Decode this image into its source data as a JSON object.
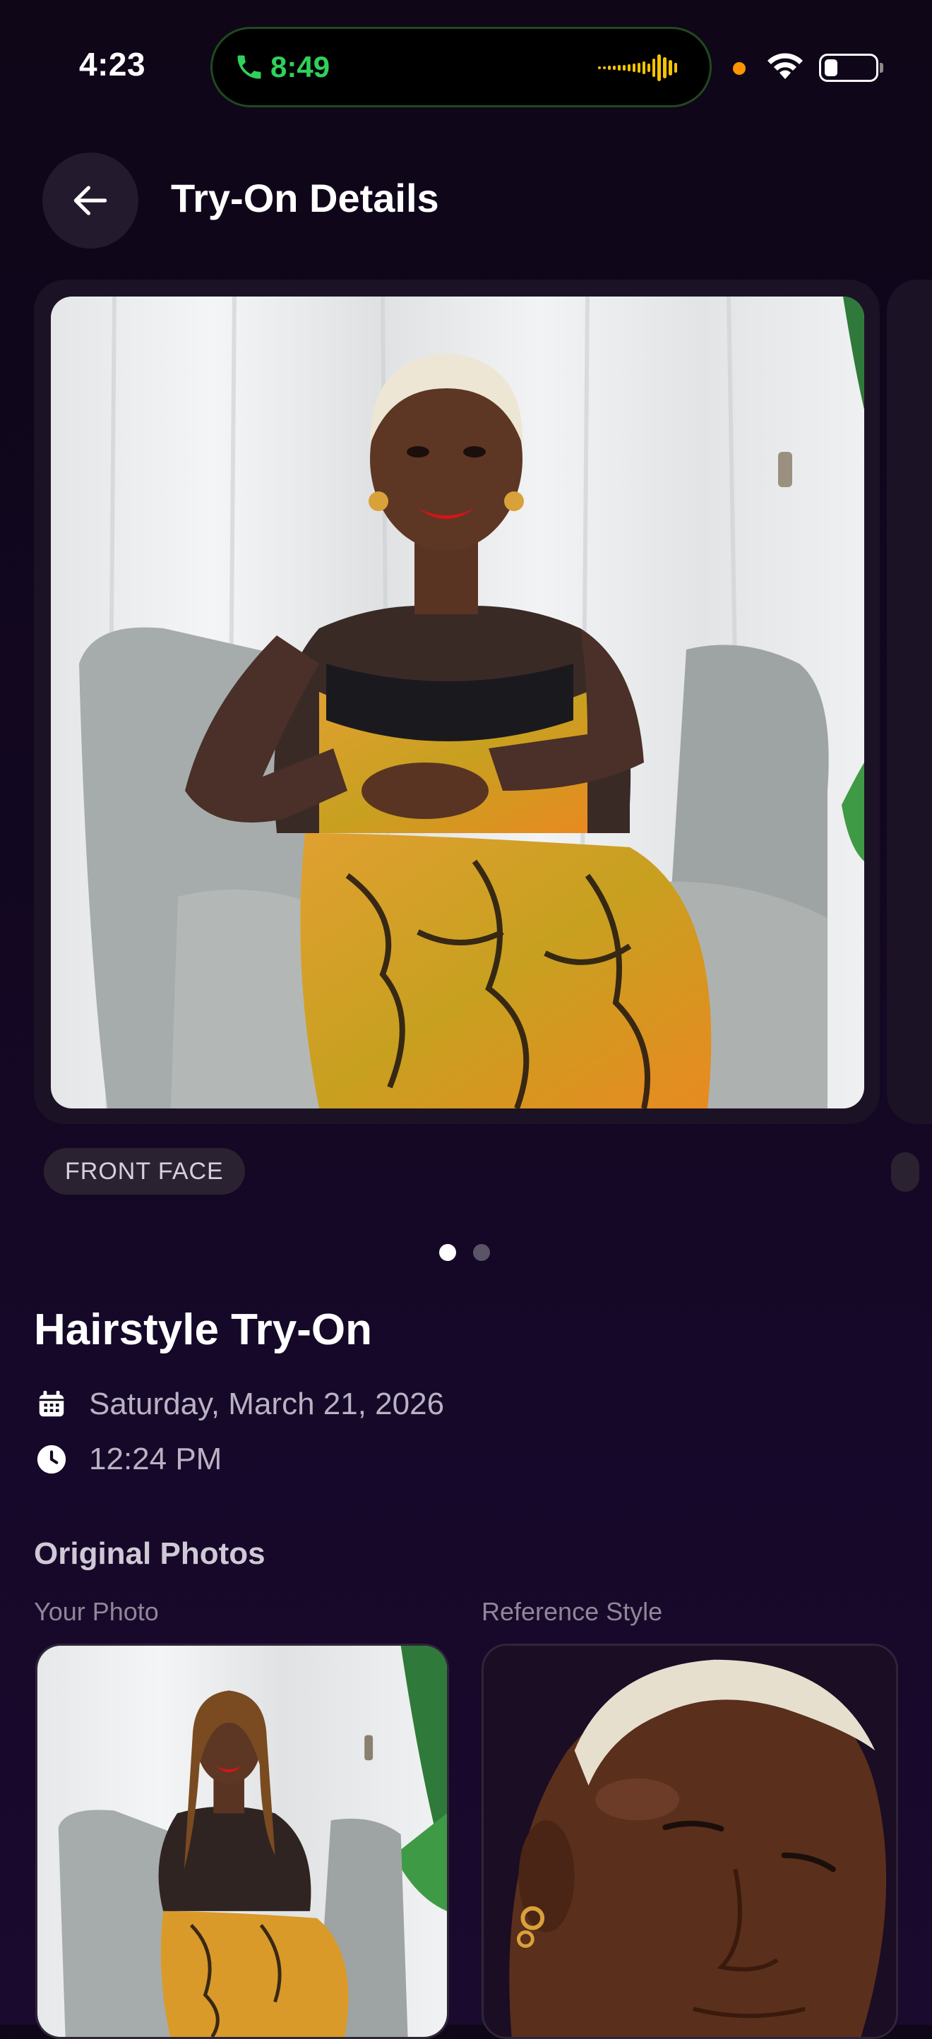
{
  "status_bar": {
    "time": "4:23",
    "call_time": "8:49",
    "call_color": "#2fd15a",
    "wave_color": "#f5c400",
    "recording_dot_color": "#ff9500",
    "icons": [
      "phone-icon",
      "waveform-icon",
      "wifi-icon",
      "battery-icon"
    ]
  },
  "header": {
    "title": "Try-On Details",
    "back_icon": "arrow-left-icon"
  },
  "carousel": {
    "badge": "FRONT FACE",
    "page_count": 2,
    "active_page": 1
  },
  "details": {
    "title": "Hairstyle Try-On",
    "date": "Saturday, March 21, 2026",
    "time": "12:24 PM",
    "icons": [
      "calendar-icon",
      "clock-icon"
    ]
  },
  "original_photos": {
    "title": "Original Photos",
    "your_photo_label": "Your Photo",
    "reference_label": "Reference Style"
  },
  "colors": {
    "background": "#120720",
    "card": "#1c1226",
    "badge": "#2a2231",
    "muted_text": "#b8b2c2"
  }
}
